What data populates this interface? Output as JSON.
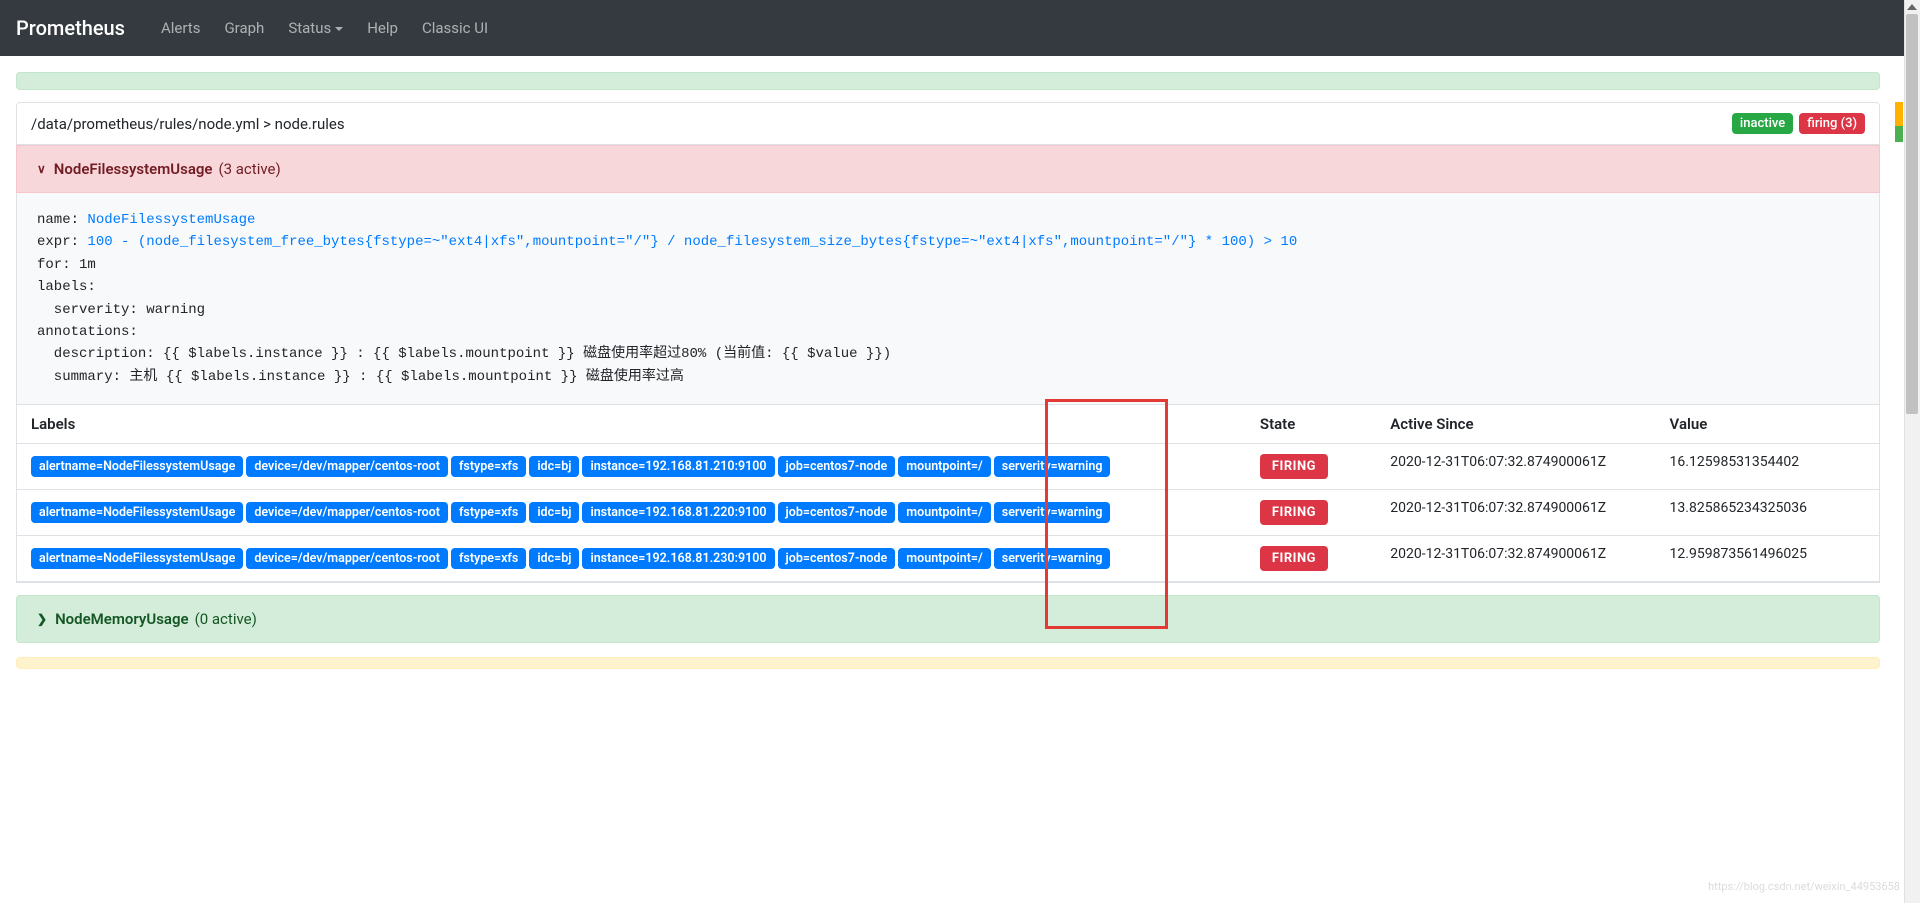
{
  "nav": {
    "brand": "Prometheus",
    "items": [
      "Alerts",
      "Graph",
      "Status",
      "Help",
      "Classic UI"
    ]
  },
  "path_bar": {
    "text": "/data/prometheus/rules/node.yml > node.rules",
    "inactive_label": "inactive",
    "firing_label": "firing (3)"
  },
  "rule_header_expanded": {
    "chevron": "∨",
    "name": "NodeFilessystemUsage",
    "count": "(3 active)"
  },
  "yaml": {
    "l1_k": "name: ",
    "l1_v": "NodeFilessystemUsage",
    "l2_k": "expr: ",
    "l2_v": "100 - (node_filesystem_free_bytes{fstype=~\"ext4|xfs\",mountpoint=\"/\"} / node_filesystem_size_bytes{fstype=~\"ext4|xfs\",mountpoint=\"/\"} * 100) > 10",
    "l3": "for: 1m",
    "l4": "labels:",
    "l5": "  serverity: warning",
    "l6": "annotations:",
    "l7": "  description: {{ $labels.instance }} : {{ $labels.mountpoint }} 磁盘使用率超过80% (当前值: {{ $value }})",
    "l8": "  summary: 主机 {{ $labels.instance }} : {{ $labels.mountpoint }} 磁盘使用率过高"
  },
  "table": {
    "headers": {
      "labels": "Labels",
      "state": "State",
      "active_since": "Active Since",
      "value": "Value"
    },
    "rows": [
      {
        "labels": [
          "alertname=NodeFilessystemUsage",
          "device=/dev/mapper/centos-root",
          "fstype=xfs",
          "idc=bj",
          "instance=192.168.81.210:9100",
          "job=centos7-node",
          "mountpoint=/",
          "serverity=warning"
        ],
        "state": "FIRING",
        "active_since": "2020-12-31T06:07:32.874900061Z",
        "value": "16.12598531354402"
      },
      {
        "labels": [
          "alertname=NodeFilessystemUsage",
          "device=/dev/mapper/centos-root",
          "fstype=xfs",
          "idc=bj",
          "instance=192.168.81.220:9100",
          "job=centos7-node",
          "mountpoint=/",
          "serverity=warning"
        ],
        "state": "FIRING",
        "active_since": "2020-12-31T06:07:32.874900061Z",
        "value": "13.825865234325036"
      },
      {
        "labels": [
          "alertname=NodeFilessystemUsage",
          "device=/dev/mapper/centos-root",
          "fstype=xfs",
          "idc=bj",
          "instance=192.168.81.230:9100",
          "job=centos7-node",
          "mountpoint=/",
          "serverity=warning"
        ],
        "state": "FIRING",
        "active_since": "2020-12-31T06:07:32.874900061Z",
        "value": "12.959873561496025"
      }
    ]
  },
  "rule_header_collapsed": {
    "chevron": "❯",
    "name": "NodeMemoryUsage",
    "count": "(0 active)"
  },
  "watermark": "https://blog.csdn.net/weixin_44953658"
}
